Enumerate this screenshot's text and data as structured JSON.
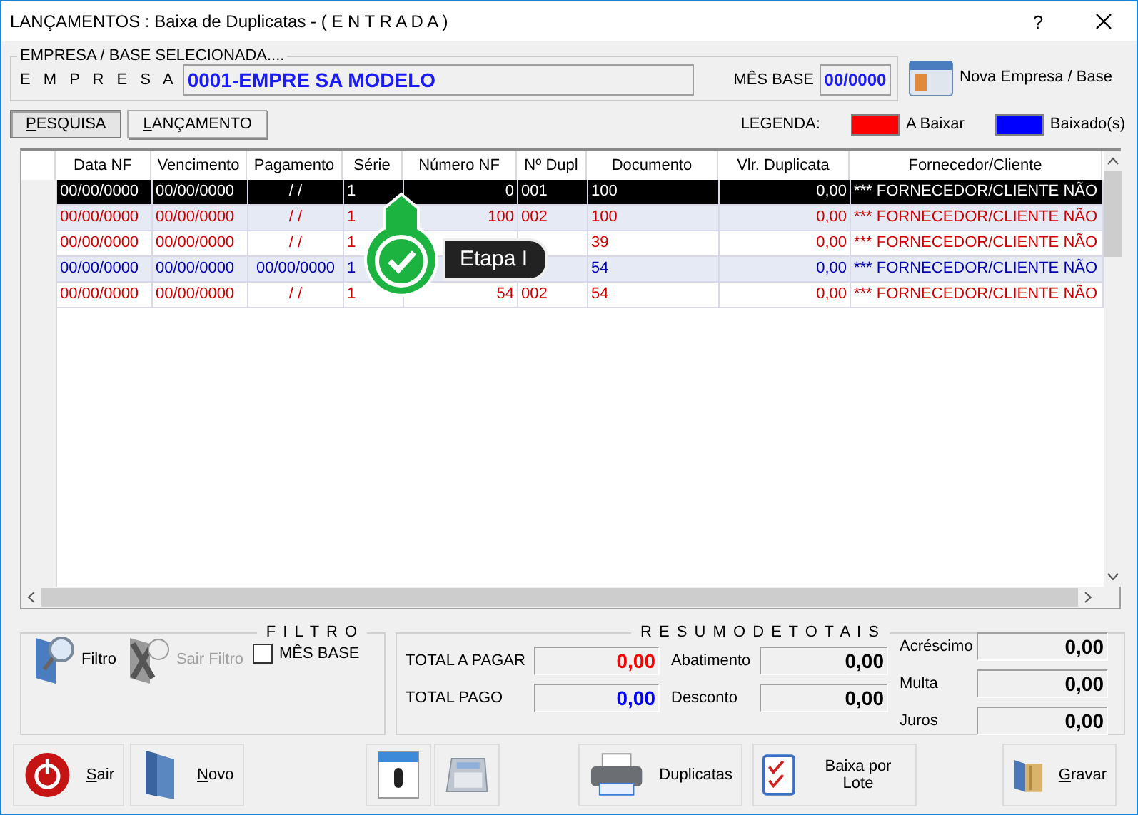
{
  "window": {
    "title": "LANÇAMENTOS : Baixa de Duplicatas - ( E N T R A D A )",
    "help": "?"
  },
  "company": {
    "legend": "EMPRESA  /  BASE  SELECIONADA....",
    "label": "E M P R E S A",
    "value": "0001-EMPRE SA MODELO",
    "month_label": "MÊS BASE",
    "month_value": "00/0000",
    "change_button": "Nova Empresa / Base"
  },
  "tabs": [
    {
      "label": "PESQUISA",
      "selected": true,
      "underline_first": true
    },
    {
      "label": "LANÇAMENTO",
      "selected": false,
      "underline_first": true
    }
  ],
  "legend": {
    "label": "LEGENDA:",
    "items": [
      {
        "label": "A Baixar",
        "color": "#ff0000"
      },
      {
        "label": "Baixado(s)",
        "color": "#0000ff"
      }
    ]
  },
  "table": {
    "columns": [
      "Data NF",
      "Vencimento",
      "Pagamento",
      "Série",
      "Número NF",
      "Nº Dupl",
      "Documento",
      "Vlr. Duplicata",
      "Fornecedor/Cliente"
    ],
    "rows": [
      {
        "selected": true,
        "cells": [
          "00/00/0000",
          "00/00/0000",
          "/ /",
          "1",
          "0",
          "001",
          "100",
          "0,00",
          "*** FORNECEDOR/CLIENTE  NÃO"
        ]
      },
      {
        "selected": false,
        "color": "#d00000",
        "cells": [
          "00/00/0000",
          "00/00/0000",
          "/ /",
          "1",
          "100",
          "002",
          "100",
          "0,00",
          "*** FORNECEDOR/CLIENTE  NÃO"
        ]
      },
      {
        "selected": false,
        "color": "#d00000",
        "cells": [
          "00/00/0000",
          "00/00/0000",
          "/ /",
          "1",
          null,
          null,
          "39",
          "0,00",
          "*** FORNECEDOR/CLIENTE  NÃO"
        ]
      },
      {
        "selected": false,
        "color": "#0000b0",
        "cells": [
          "00/00/0000",
          "00/00/0000",
          "00/00/0000",
          "1",
          null,
          null,
          "54",
          "0,00",
          "*** FORNECEDOR/CLIENTE  NÃO"
        ]
      },
      {
        "selected": false,
        "color": "#d00000",
        "cells": [
          "00/00/0000",
          "00/00/0000",
          "/ /",
          "1",
          "54",
          "002",
          "54",
          "0,00",
          "*** FORNECEDOR/CLIENTE  NÃO"
        ]
      }
    ]
  },
  "step_badge": {
    "label": "Etapa I"
  },
  "filter": {
    "title": "F I L T R O",
    "buttons": [
      {
        "label": "Filtro",
        "disabled": false,
        "kind": "filter"
      },
      {
        "label": "Sair Filtro",
        "disabled": true,
        "kind": "clear"
      }
    ],
    "checkbox": {
      "label": "MÊS BASE",
      "checked": false
    }
  },
  "totals": {
    "title": "R E S U M O   D E   T O T A I S",
    "columns": [
      [
        {
          "label": "TOTAL A PAGAR",
          "value": "0,00",
          "color": "#ff0000"
        },
        {
          "label": "TOTAL PAGO",
          "value": "0,00",
          "color": "#0000ff"
        }
      ],
      [
        {
          "label": "Abatimento",
          "value": "0,00",
          "color": "#000000"
        },
        {
          "label": "Desconto",
          "value": "0,00",
          "color": "#000000"
        }
      ],
      [
        {
          "label": "Acréscimo",
          "value": "0,00",
          "color": "#000000"
        },
        {
          "label": "Multa",
          "value": "0,00",
          "color": "#000000"
        },
        {
          "label": "Juros",
          "value": "0,00",
          "color": "#000000"
        }
      ]
    ]
  },
  "actions": [
    {
      "kind": "exit",
      "label": "Sair",
      "underline_first": true
    },
    {
      "kind": "new",
      "label": "Novo",
      "underline_first": true
    },
    {
      "kind": "calendar"
    },
    {
      "kind": "calculator"
    },
    {
      "kind": "print",
      "label": "Duplicatas",
      "underline_first": false
    },
    {
      "kind": "batch",
      "label": "Baixa por Lote",
      "underline_first": false
    },
    {
      "kind": "save",
      "label": "Gravar",
      "underline_first": true
    }
  ]
}
